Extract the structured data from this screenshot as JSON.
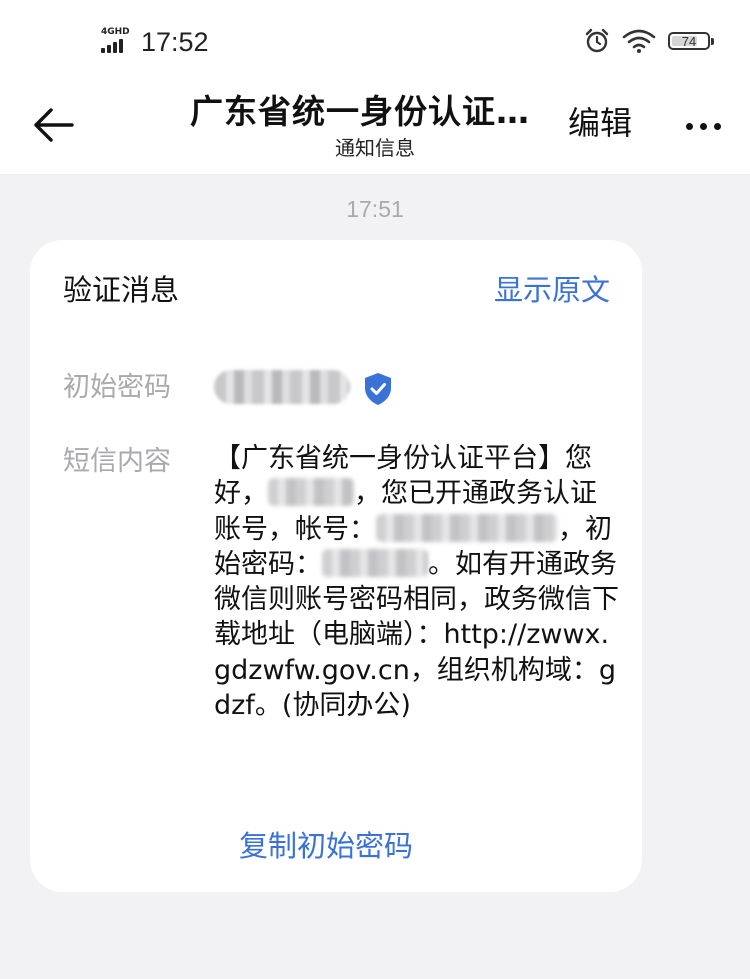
{
  "status_bar": {
    "network": "4GHD",
    "time": "17:52",
    "battery": "74",
    "battery_level": 0.74
  },
  "header": {
    "title": "广东省统一身份认证平台",
    "subtitle": "通知信息",
    "edit_label": "编辑"
  },
  "message": {
    "time": "17:51",
    "card_title": "验证消息",
    "show_original_label": "显示原文",
    "password_label": "初始密码",
    "content_label": "短信内容",
    "content_parts": {
      "p1": "【广东省统一身份认证平台】您好，",
      "p2": "，您已开通政务认证账号，帐号：",
      "p3": "，初始密码：",
      "p4": "。如有开通政务微信则账号密码相同，政务微信下载地址（电脑端）：http://zwwx.gdzwfw.gov.cn，组织机构域：gdzf。(协同办公)"
    },
    "copy_label": "复制初始密码"
  },
  "colors": {
    "accent": "#3a72d8",
    "background": "#f2f2f4",
    "card": "#ffffff",
    "muted_text": "#a9a9ae"
  }
}
